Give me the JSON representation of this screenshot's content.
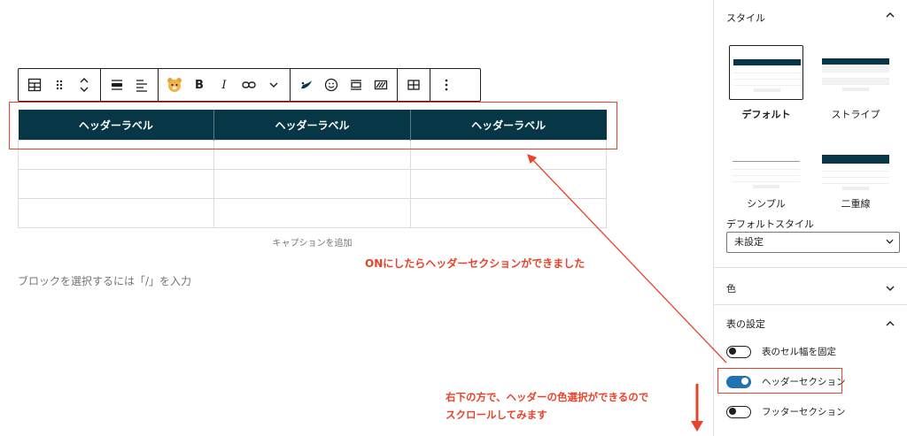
{
  "editor": {
    "table": {
      "headers": [
        "ヘッダーラベル",
        "ヘッダーラベル",
        "ヘッダーラベル"
      ],
      "rows": [
        [
          "",
          "",
          ""
        ],
        [
          "",
          "",
          ""
        ],
        [
          "",
          "",
          ""
        ]
      ]
    },
    "caption_placeholder": "キャプションを追加",
    "block_placeholder": "ブロックを選択するには「/」を入力"
  },
  "annotations": {
    "note1": "ONにしたらヘッダーセクションができました",
    "note2_line1": "右下の方で、ヘッダーの色選択ができるので",
    "note2_line2": "スクロールしてみます"
  },
  "toolbar": {
    "bold": "B",
    "italic": "I"
  },
  "sidebar": {
    "style_section": "スタイル",
    "styles": [
      "デフォルト",
      "ストライプ",
      "シンプル",
      "二重線"
    ],
    "default_style_label": "デフォルトスタイル",
    "default_style_value": "未設定",
    "color_section": "色",
    "table_settings_section": "表の設定",
    "toggles": [
      {
        "label": "表のセル幅を固定",
        "on": false
      },
      {
        "label": "ヘッダーセクション",
        "on": true
      },
      {
        "label": "フッターセクション",
        "on": false
      }
    ]
  },
  "colors": {
    "header_bg": "#073646",
    "annotation": "#e8432a",
    "toggle_on": "#2271b1"
  }
}
